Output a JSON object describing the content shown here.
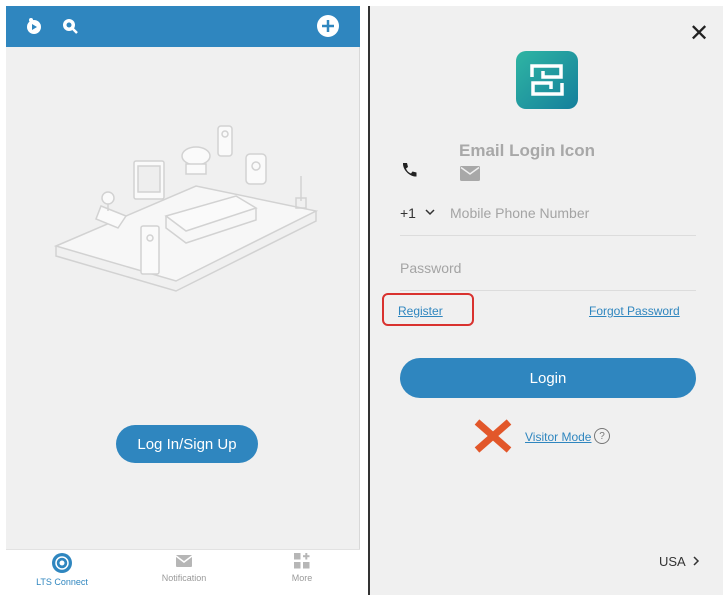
{
  "left": {
    "login_signup_label": "Log In/Sign Up",
    "tabs": [
      {
        "label": "LTS Connect",
        "icon": "lts-connect-icon",
        "active": true
      },
      {
        "label": "Notification",
        "icon": "mail-icon",
        "active": false
      },
      {
        "label": "More",
        "icon": "grid-plus-icon",
        "active": false
      }
    ]
  },
  "right": {
    "email_login_label": "Email Login Icon",
    "country_code": "+1",
    "phone_placeholder": "Mobile Phone Number",
    "password_placeholder": "Password",
    "register_label": "Register",
    "forgot_label": "Forgot Password",
    "login_label": "Login",
    "visitor_label": "Visitor Mode",
    "help_glyph": "?",
    "region_label": "USA",
    "close_glyph": "✕"
  },
  "colors": {
    "accent": "#2f86bf",
    "highlight": "#d9322f",
    "cross": "#e2572a",
    "logo_start": "#2fb5a3",
    "logo_end": "#157f9c"
  }
}
